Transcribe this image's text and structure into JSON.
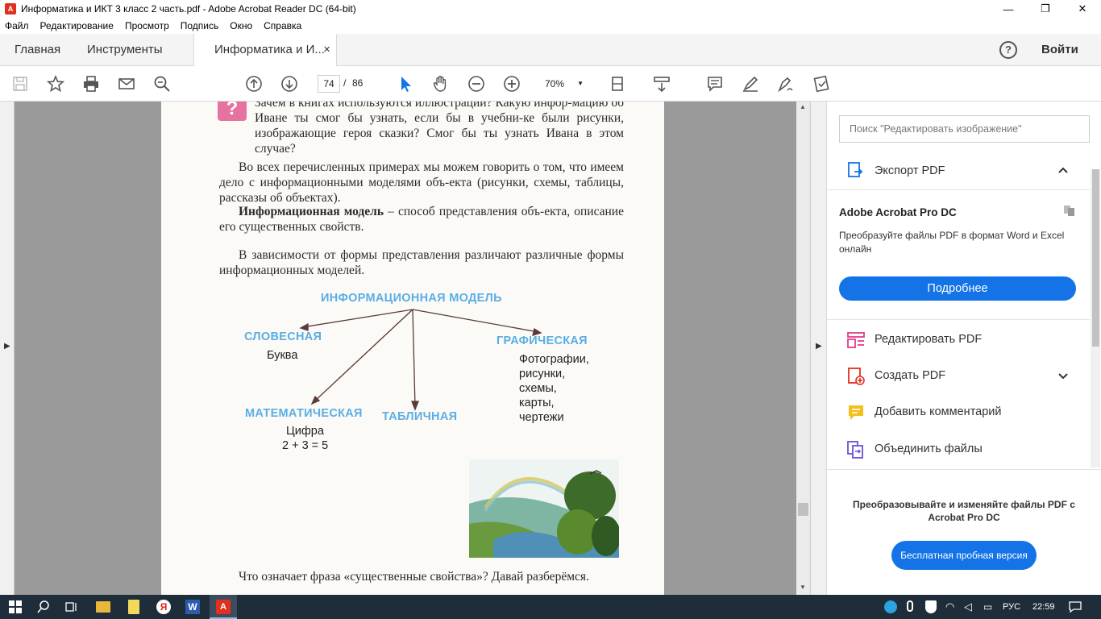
{
  "window": {
    "title": "Информатика и ИКТ 3 класс 2 часть.pdf - Adobe Acrobat Reader DC (64-bit)",
    "minimize": "—",
    "maximize": "❐",
    "close": "✕"
  },
  "menu": [
    "Файл",
    "Редактирование",
    "Просмотр",
    "Подпись",
    "Окно",
    "Справка"
  ],
  "tabs": {
    "home": "Главная",
    "tools": "Инструменты",
    "doc": "Информатика и И...",
    "doc_close": "✕",
    "help": "?",
    "signin": "Войти"
  },
  "toolbar": {
    "page_current": "74",
    "page_sep": "/",
    "page_total": "86",
    "zoom": "70%"
  },
  "page": {
    "q_text": "Зачем в книгах используются иллюстрации? Какую инфор-мацию об Иване ты смог бы узнать, если бы в учебни-ке были рисунки, изображающие героя сказки? Смог бы ты узнать Ивана в этом случае?",
    "para1": "Во всех перечисленных примерах мы можем говорить о том, что имеем дело с информационными моделями объ-екта (рисунки, схемы, таблицы, рассказы об объектах).",
    "para2_bold": "Информационная модель",
    "para2_rest": " – способ представления объ-екта, описание его существенных свойств.",
    "para3": "В зависимости от формы представления различают различные формы информационных моделей.",
    "diagram": {
      "root": "ИНФОРМАЦИОННАЯ МОДЕЛЬ",
      "verbal": "СЛОВЕСНАЯ",
      "verbal_ex": "Буква",
      "graphic": "ГРАФИЧЕСКАЯ",
      "graphic_ex": [
        "Фотографии,",
        "рисунки,",
        "схемы,",
        "карты,",
        "чертежи"
      ],
      "math": "МАТЕМАТИЧЕСКАЯ",
      "math_ex1": "Цифра",
      "math_ex2": "2 + 3 = 5",
      "table": "ТАБЛИЧНАЯ"
    },
    "bottom_text": "Что означает фраза «существенные свойства»? Давай разберёмся."
  },
  "sidepanel": {
    "search_placeholder": "Поиск \"Редактировать изображение\"",
    "export_label": "Экспорт PDF",
    "promo_title": "Adobe Acrobat Pro DC",
    "promo_text": "Преобразуйте файлы PDF в формат Word и Excel онлайн",
    "more_button": "Подробнее",
    "tools": [
      "Редактировать PDF",
      "Создать PDF",
      "Добавить комментарий",
      "Объединить файлы"
    ],
    "footer_text": "Преобразовывайте и изменяйте файлы PDF с Acrobat Pro DC",
    "trial_button": "Бесплатная пробная версия"
  },
  "taskbar": {
    "lang": "РУС",
    "time": "22:59"
  },
  "colors": {
    "accent_blue": "#1473e6",
    "diagram_blue": "#5aaee4",
    "taskbar": "#1f2d3a"
  }
}
